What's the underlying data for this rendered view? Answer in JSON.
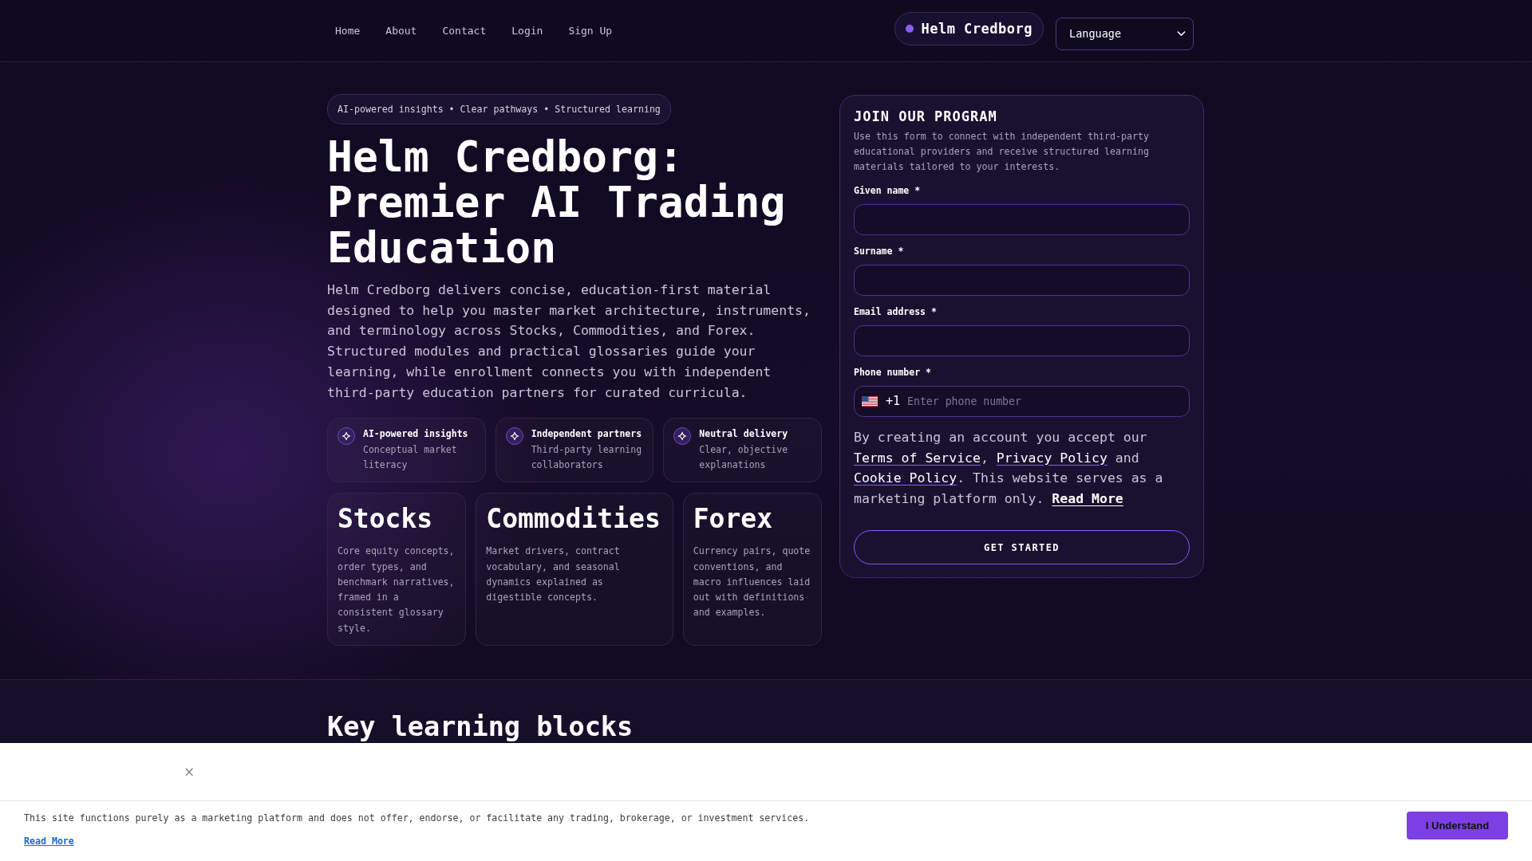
{
  "nav": {
    "links": [
      {
        "label": "Home"
      },
      {
        "label": "About"
      },
      {
        "label": "Contact"
      },
      {
        "label": "Login"
      },
      {
        "label": "Sign Up"
      }
    ],
    "brand": "Helm Credborg",
    "language_select": {
      "value": "Language"
    }
  },
  "hero": {
    "tagline": "AI-powered insights • Clear pathways • Structured learning",
    "title": "Helm Credborg: Premier AI Trading Education",
    "description": "Helm Credborg delivers concise, education-first material designed to help you master market architecture, instruments, and terminology across Stocks, Commodities, and Forex. Structured modules and practical glossaries guide your learning, while enrollment connects you with independent third-party education partners for curated curricula.",
    "features": [
      {
        "title": "AI-powered insights",
        "text": "Conceptual market literacy"
      },
      {
        "title": "Independent partners",
        "text": "Third-party learning collaborators"
      },
      {
        "title": "Neutral delivery",
        "text": "Clear, objective explanations"
      }
    ],
    "categories": [
      {
        "title": "Stocks",
        "text": "Core equity concepts, order types, and benchmark narratives, framed in a consistent glossary style."
      },
      {
        "title": "Commodities",
        "text": "Market drivers, contract vocabulary, and seasonal dynamics explained as digestible concepts."
      },
      {
        "title": "Forex",
        "text": "Currency pairs, quote conventions, and macro influences laid out with definitions and examples."
      }
    ]
  },
  "signup_form": {
    "title": "JOIN OUR PROGRAM",
    "description": "Use this form to connect with independent third-party educational providers and receive structured learning materials tailored to your interests.",
    "fields": [
      {
        "kind": "text",
        "label": "Given name *"
      },
      {
        "kind": "text",
        "label": "Surname *"
      },
      {
        "kind": "text",
        "label": "Email address *"
      },
      {
        "kind": "phone",
        "label": "Phone number *",
        "country_code": "+1",
        "placeholder": "Enter phone number"
      }
    ],
    "consent": [
      {
        "kind": "text",
        "text": "By creating an account you accept our "
      },
      {
        "kind": "link",
        "text": "Terms of Service"
      },
      {
        "kind": "text",
        "text": ", "
      },
      {
        "kind": "link",
        "text": "Privacy Policy"
      },
      {
        "kind": "text",
        "text": " and "
      },
      {
        "kind": "link",
        "text": "Cookie Policy"
      },
      {
        "kind": "text",
        "text": ". This website serves as a marketing platform only. "
      },
      {
        "kind": "strong_link",
        "text": "Read More"
      }
    ],
    "submit": "GET STARTED"
  },
  "next_section": {
    "title": "Key learning blocks"
  },
  "cookie_banner": {
    "close": "×",
    "text": "This site functions purely as a marketing platform and does not offer, endorse, or facilitate any trading, brokerage, or investment services.",
    "link": "Read More",
    "button": "I Understand"
  }
}
